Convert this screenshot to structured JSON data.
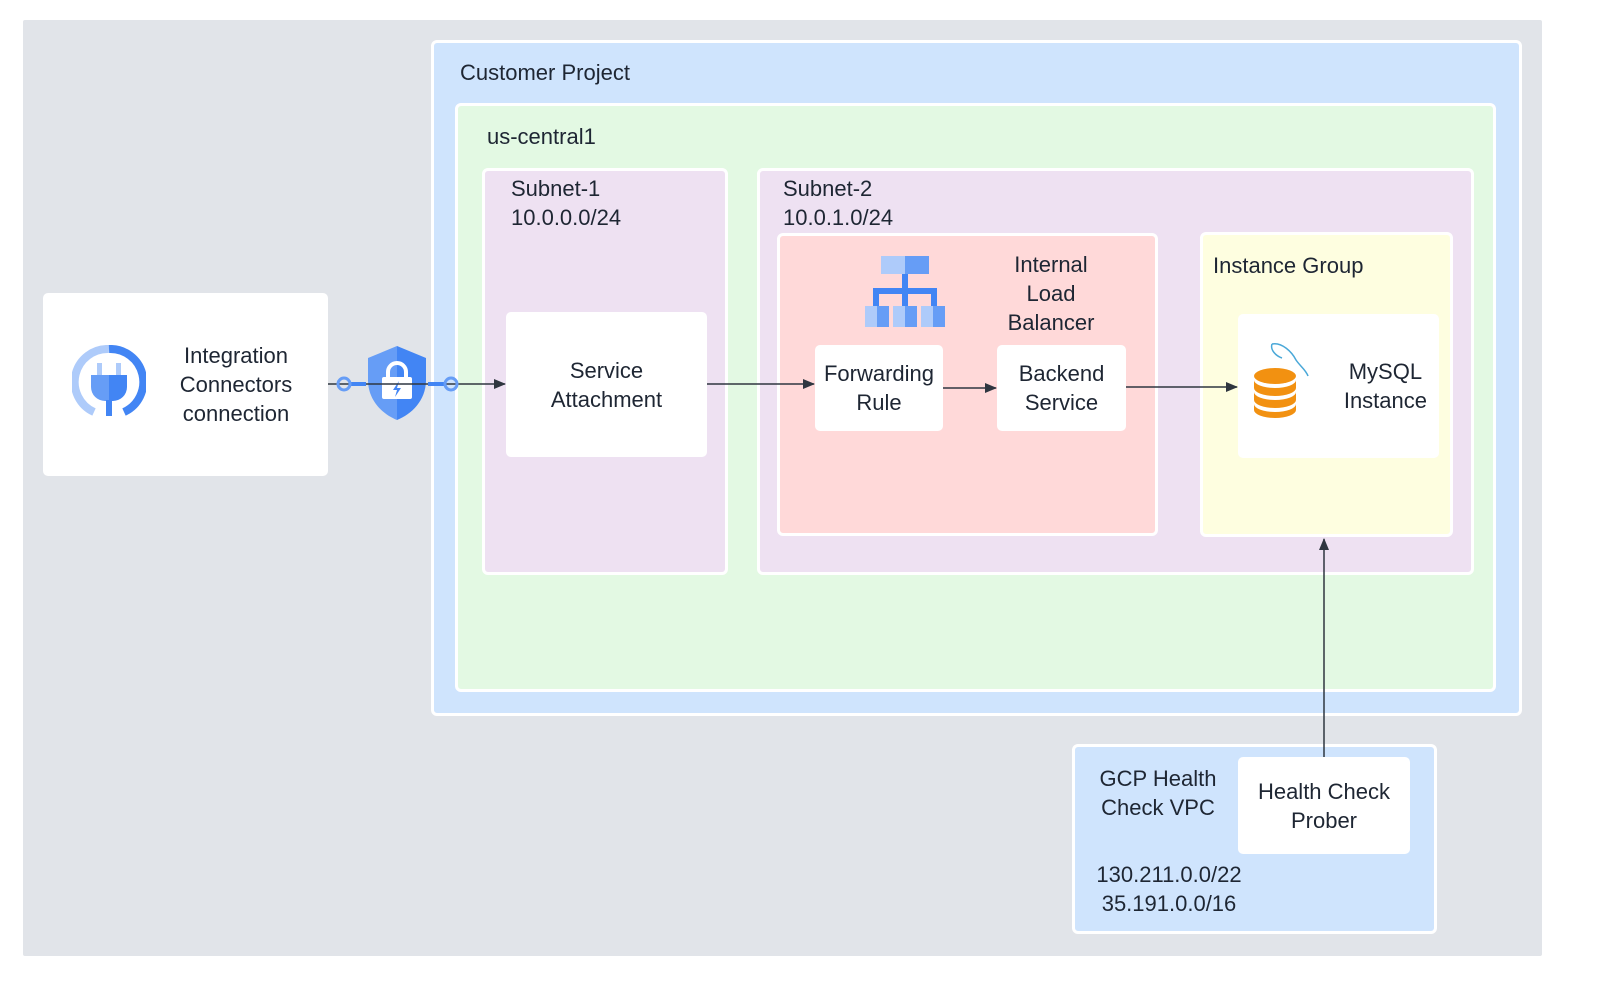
{
  "customer_project": {
    "label": "Customer Project"
  },
  "region": {
    "label": "us-central1"
  },
  "subnet1": {
    "name": "Subnet-1",
    "cidr": "10.0.0.0/24",
    "service_attachment": "Service\nAttachment"
  },
  "subnet2": {
    "name": "Subnet-2",
    "cidr": "10.0.1.0/24"
  },
  "load_balancer": {
    "label": "Internal\nLoad\nBalancer",
    "forwarding_rule": "Forwarding\nRule",
    "backend_service": "Backend\nService"
  },
  "instance_group": {
    "label": "Instance Group",
    "mysql": "MySQL\nInstance"
  },
  "integration": {
    "label": "Integration\nConnectors\nconnection"
  },
  "health_check": {
    "vpc_label": "GCP Health\nCheck VPC",
    "prober": "Health Check\nProber",
    "ranges": "130.211.0.0/22\n35.191.0.0/16"
  },
  "colors": {
    "background": "#e1e4e9",
    "project": "#cfe4fd",
    "region": "#e3f9e3",
    "subnet": "#eee1f2",
    "load_balancer": "#ffd9d9",
    "instance_group": "#fefee0",
    "gcp_blue": "#4285f4",
    "mysql_orange": "#f29111"
  },
  "icons": [
    "integration-connectors-icon",
    "private-service-connect-shield-icon",
    "load-balancer-icon",
    "mysql-database-icon"
  ]
}
